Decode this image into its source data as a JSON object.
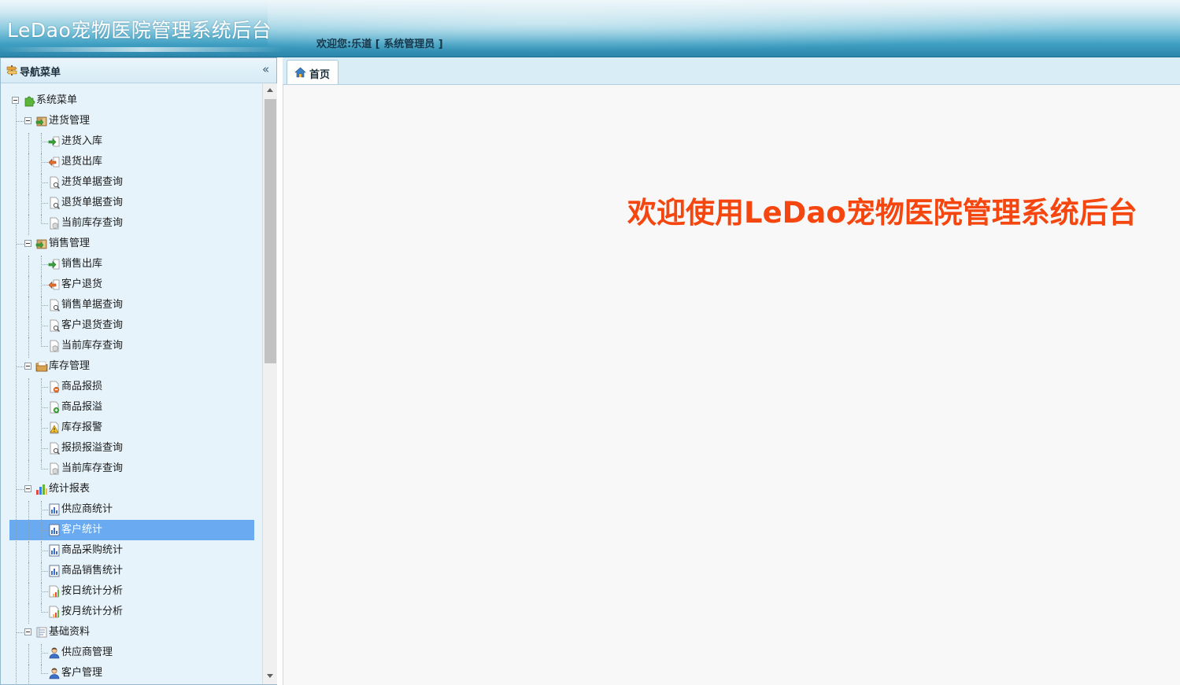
{
  "header": {
    "app_title": "LeDao宠物医院管理系统后台",
    "welcome_text": "欢迎您:乐道 [ 系统管理员 ]"
  },
  "nav": {
    "title": "导航菜单",
    "collapse_symbol": "«",
    "root": "系统菜单",
    "groups": [
      {
        "label": "进货管理",
        "icon": "import-folder-icon",
        "items": [
          {
            "label": "进货入库",
            "icon": "arrow-in-icon"
          },
          {
            "label": "退货出库",
            "icon": "arrow-out-icon"
          },
          {
            "label": "进货单据查询",
            "icon": "doc-search-icon"
          },
          {
            "label": "退货单据查询",
            "icon": "doc-search-icon"
          },
          {
            "label": "当前库存查询",
            "icon": "database-icon"
          }
        ]
      },
      {
        "label": "销售管理",
        "icon": "sale-folder-icon",
        "items": [
          {
            "label": "销售出库",
            "icon": "arrow-in-icon"
          },
          {
            "label": "客户退货",
            "icon": "arrow-out-icon"
          },
          {
            "label": "销售单据查询",
            "icon": "doc-search-icon"
          },
          {
            "label": "客户退货查询",
            "icon": "doc-search-icon"
          },
          {
            "label": "当前库存查询",
            "icon": "database-icon"
          }
        ]
      },
      {
        "label": "库存管理",
        "icon": "stock-folder-icon",
        "items": [
          {
            "label": "商品报损",
            "icon": "doc-minus-icon"
          },
          {
            "label": "商品报溢",
            "icon": "doc-plus-icon"
          },
          {
            "label": "库存报警",
            "icon": "warning-icon"
          },
          {
            "label": "报损报溢查询",
            "icon": "doc-search-icon"
          },
          {
            "label": "当前库存查询",
            "icon": "database-icon"
          }
        ]
      },
      {
        "label": "统计报表",
        "icon": "chart-folder-icon",
        "items": [
          {
            "label": "供应商统计",
            "icon": "bar-report-icon"
          },
          {
            "label": "客户统计",
            "icon": "bar-report-icon",
            "selected": true
          },
          {
            "label": "商品采购统计",
            "icon": "bar-report-icon"
          },
          {
            "label": "商品销售统计",
            "icon": "bar-report-icon"
          },
          {
            "label": "按日统计分析",
            "icon": "chart-doc-icon"
          },
          {
            "label": "按月统计分析",
            "icon": "chart-doc-icon"
          }
        ]
      },
      {
        "label": "基础资料",
        "icon": "basic-data-icon",
        "items": [
          {
            "label": "供应商管理",
            "icon": "user-icon"
          },
          {
            "label": "客户管理",
            "icon": "user-icon"
          }
        ]
      }
    ]
  },
  "tabs": [
    {
      "label": "首页",
      "icon": "home-icon"
    }
  ],
  "content": {
    "welcome_message": "欢迎使用LeDao宠物医院管理系统后台"
  },
  "colors": {
    "welcome_message": "#f5460f",
    "selected_row": "#6aaaf0",
    "nav_bg": "#e6f3fa"
  }
}
